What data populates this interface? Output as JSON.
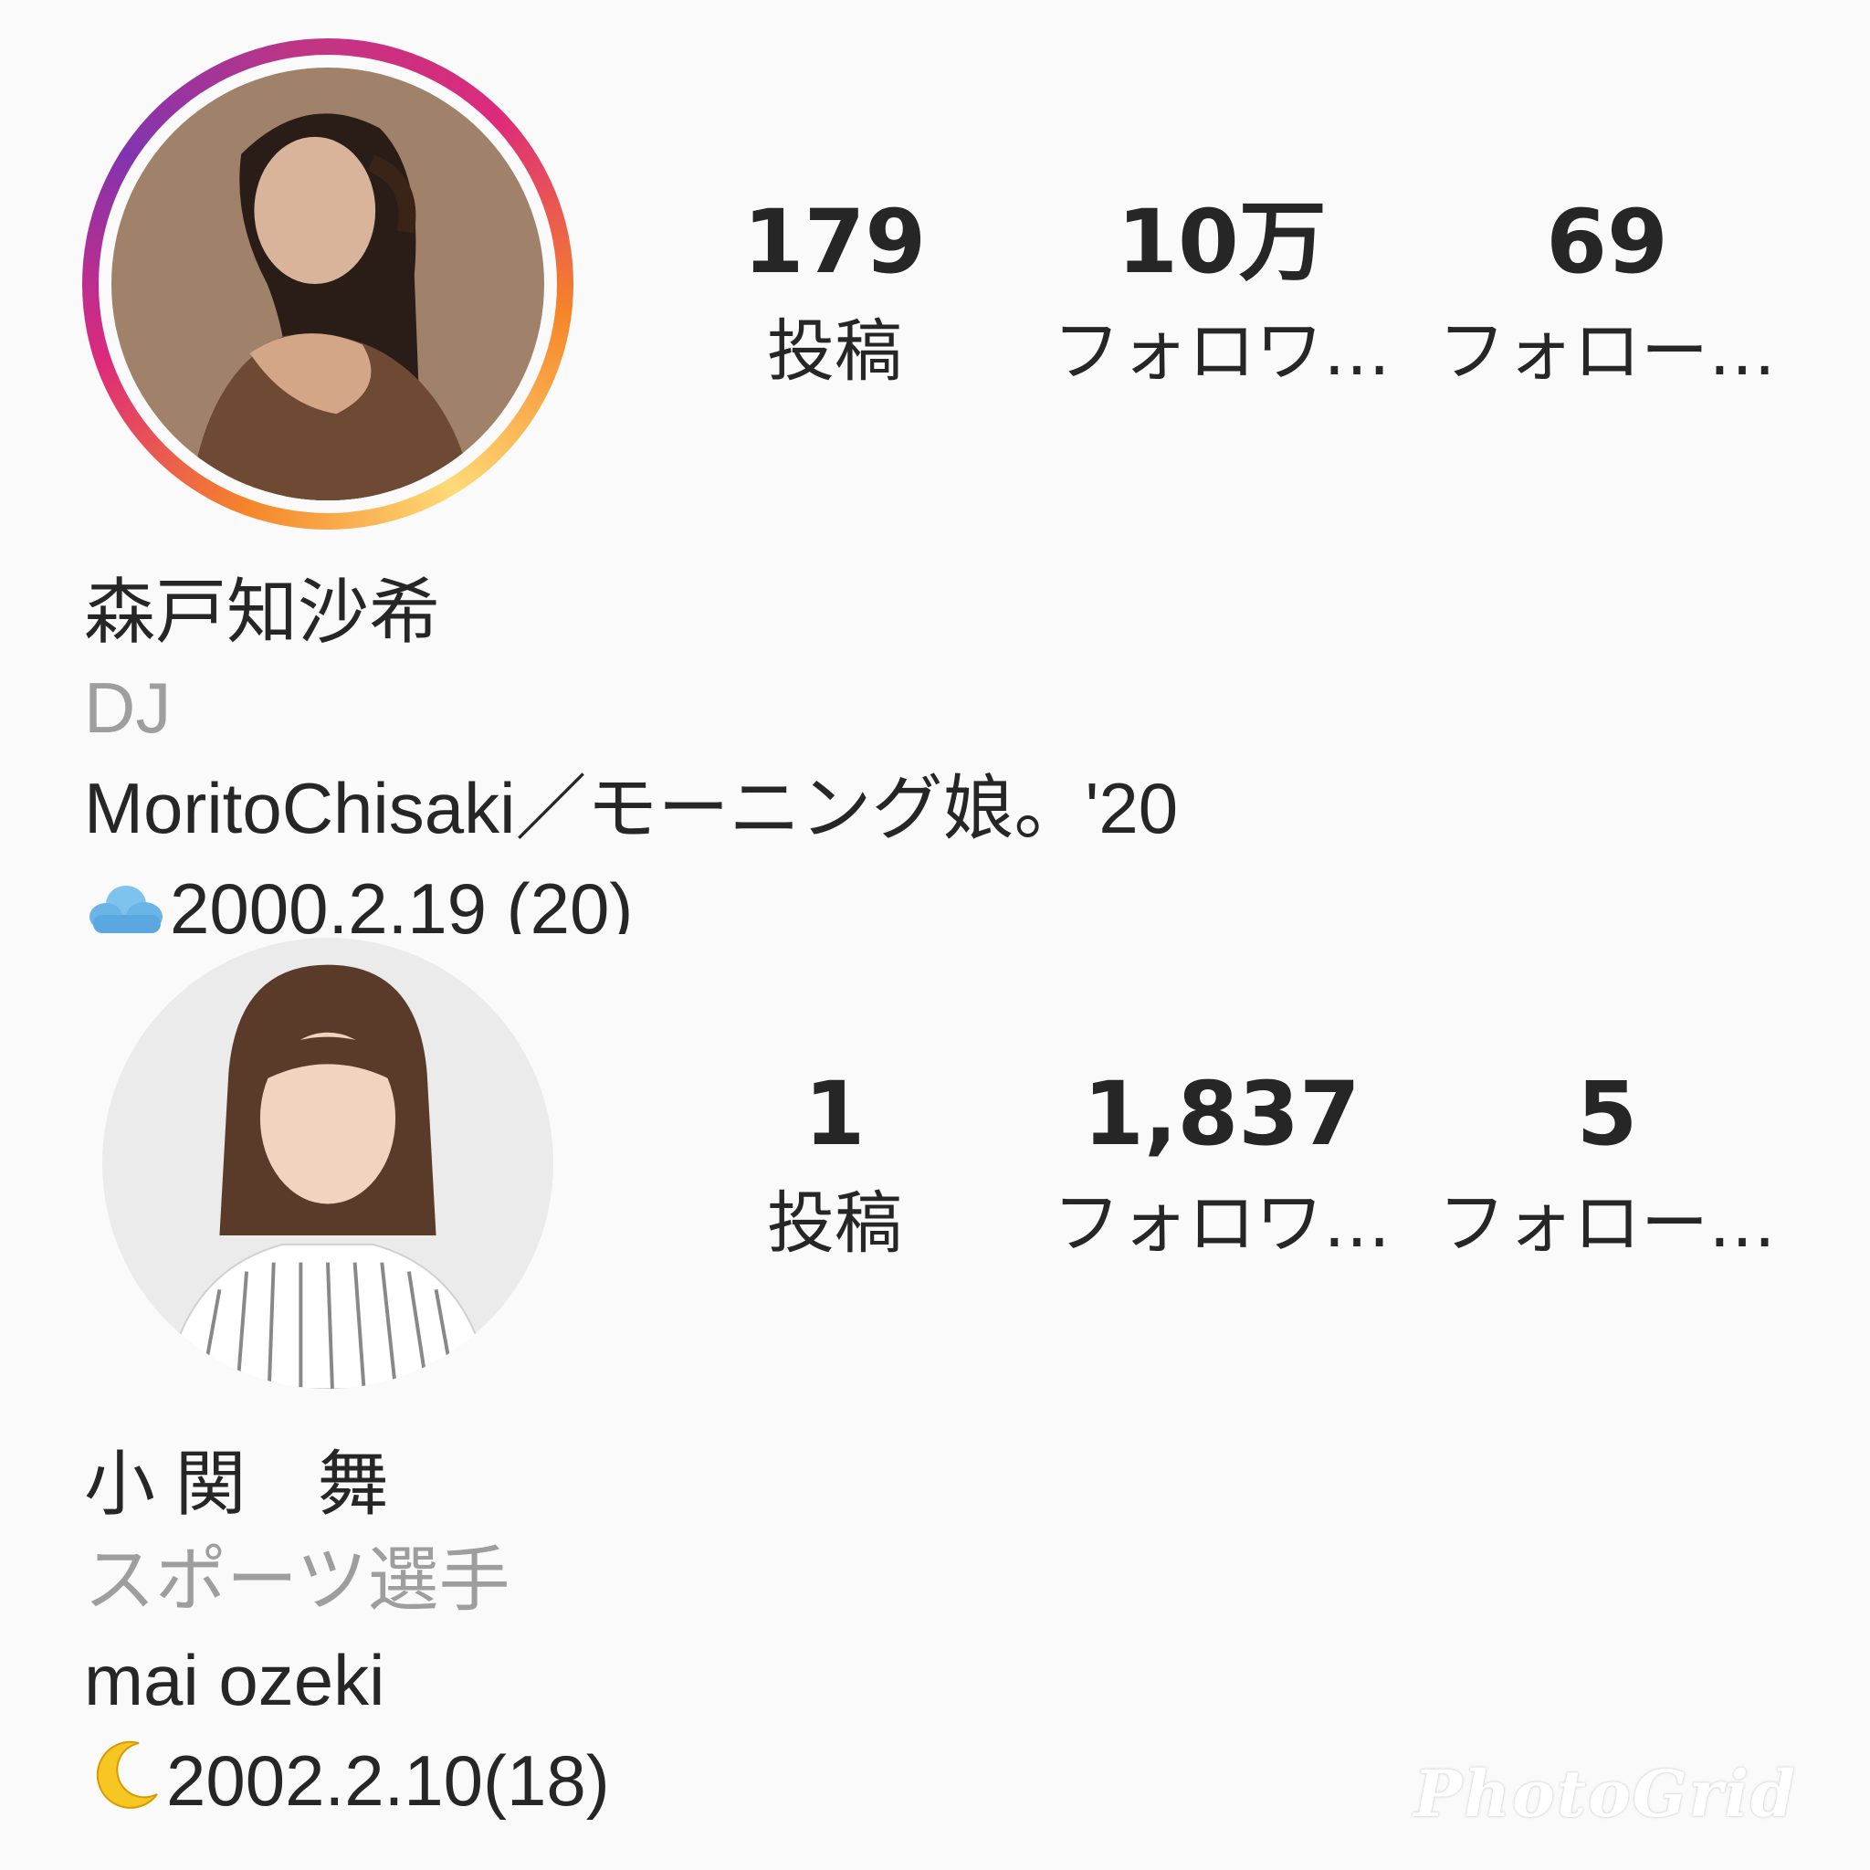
{
  "profiles": [
    {
      "avatar_icon": "profile-photo-with-story-ring",
      "stats": {
        "posts_count": "179",
        "posts_label": "投稿",
        "followers_count": "10万",
        "followers_label": "フォロワ…",
        "following_count": "69",
        "following_label": "フォロー…"
      },
      "display_name": "森戸知沙希",
      "category": "DJ",
      "bio_line1": "MoritoChisaki／モーニング娘。'20",
      "bio_line2_emoji": "cloud-emoji",
      "bio_line2": "2000.2.19 (20)"
    },
    {
      "avatar_icon": "profile-photo",
      "stats": {
        "posts_count": "1",
        "posts_label": "投稿",
        "followers_count": "1,837",
        "followers_label": "フォロワ…",
        "following_count": "5",
        "following_label": "フォロー…"
      },
      "display_name": "小 関　舞",
      "category": "スポーツ選手",
      "bio_line1": "mai ozeki",
      "bio_line2_emoji": "crescent-moon-emoji",
      "bio_line2": "2002.2.10(18)"
    }
  ],
  "watermark": "PhotoGrid",
  "colors": {
    "background": "#fafafa",
    "text": "#262626",
    "category_text": "#9e9e9e",
    "story_ring": [
      "#f58529",
      "#dd2a7b",
      "#8134af"
    ]
  }
}
